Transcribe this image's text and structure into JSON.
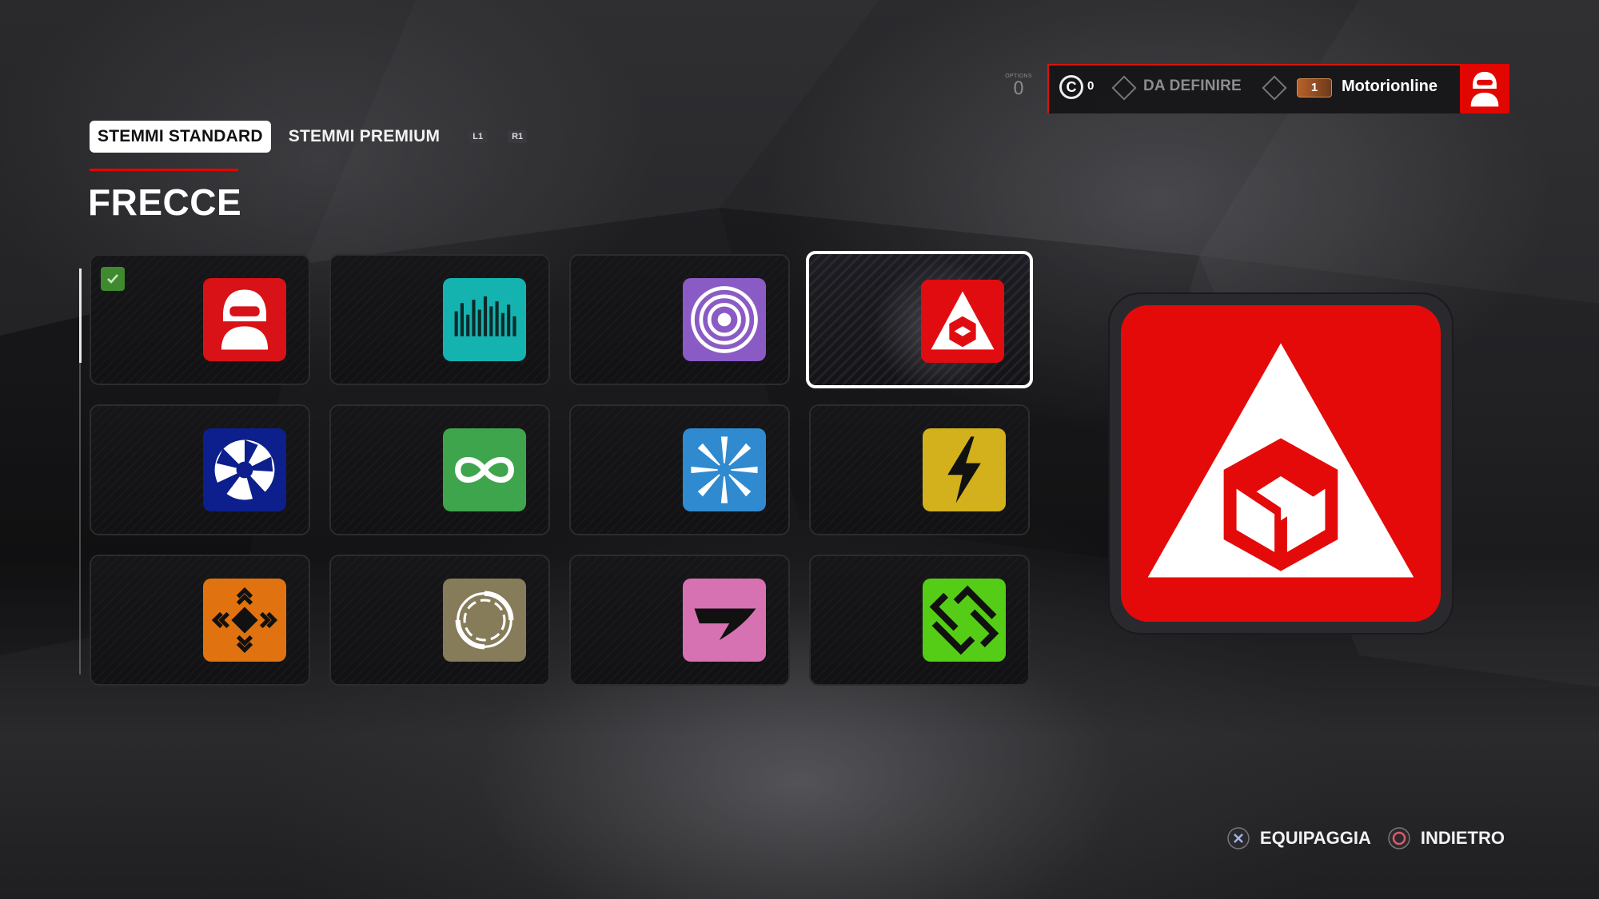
{
  "tabs": {
    "standard_label": "STEMMI STANDARD",
    "premium_label": "STEMMI PREMIUM",
    "hint_left": "L1",
    "hint_right": "R1"
  },
  "section_title": "FRECCE",
  "header": {
    "options_label": "OPTIONS",
    "options_value": "0",
    "coin_symbol": "C",
    "coin_value": "0",
    "status_label": "DA DEFINIRE",
    "level_value": "1",
    "username": "Motorionline"
  },
  "emblems": [
    {
      "icon": "helmet-driver-icon",
      "color": "#d81216",
      "equipped": true
    },
    {
      "icon": "soundwave-icon",
      "color": "#14b3b0"
    },
    {
      "icon": "concentric-rings-icon",
      "color": "#8a5bc4"
    },
    {
      "icon": "triangle-cube-icon",
      "color": "#e10c10",
      "selected": true
    },
    {
      "icon": "aperture-icon",
      "color": "#0c1f8c"
    },
    {
      "icon": "infinity-knot-icon",
      "color": "#3ea54c"
    },
    {
      "icon": "radial-burst-icon",
      "color": "#2f8ad0"
    },
    {
      "icon": "lightning-bolt-icon",
      "color": "#d2b11c"
    },
    {
      "icon": "four-arrows-icon",
      "color": "#e0730f"
    },
    {
      "icon": "swirl-ring-icon",
      "color": "#877c5a"
    },
    {
      "icon": "swoosh-flag-icon",
      "color": "#d672b2"
    },
    {
      "icon": "chain-arrows-icon",
      "color": "#55cc16"
    }
  ],
  "preview": {
    "icon": "triangle-cube-icon",
    "color": "#e40a0a"
  },
  "prompts": {
    "equip_label": "EQUIPAGGIA",
    "back_label": "INDIETRO"
  }
}
